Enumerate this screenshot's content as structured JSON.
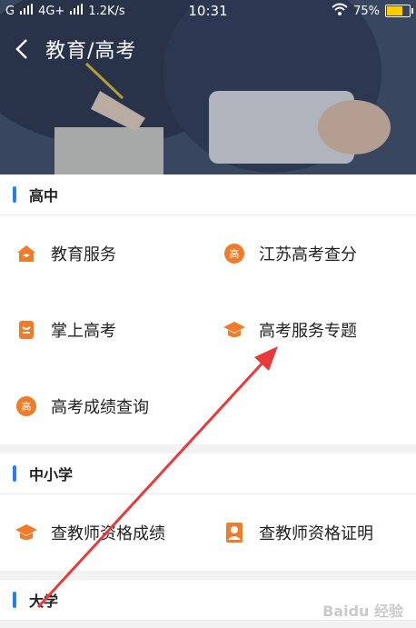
{
  "status_bar": {
    "carrier_left": "G",
    "network": "4G+",
    "speed": "1.2K/s",
    "time": "10:31",
    "battery_percent": "75%",
    "battery_level": 0.75
  },
  "header": {
    "title": "教育/高考"
  },
  "sections": [
    {
      "title": "高中",
      "items": [
        {
          "label": "教育服务",
          "icon": "house-icon"
        },
        {
          "label": "江苏高考查分",
          "icon": "gao-badge-icon"
        },
        {
          "label": "掌上高考",
          "icon": "phone-badge-icon"
        },
        {
          "label": "高考服务专题",
          "icon": "mortarboard-icon"
        },
        {
          "label": "高考成绩查询",
          "icon": "gao-badge-icon"
        }
      ]
    },
    {
      "title": "中小学",
      "items": [
        {
          "label": "查教师资格成绩",
          "icon": "mortarboard-icon"
        },
        {
          "label": "查教师资格证明",
          "icon": "person-id-icon"
        }
      ]
    },
    {
      "title": "大学",
      "items": []
    }
  ],
  "colors": {
    "accent": "#2a7ff0",
    "icon_orange": "#f07b2a",
    "annotation_red": "#e83a3a"
  },
  "watermark": "Baidu 经验"
}
